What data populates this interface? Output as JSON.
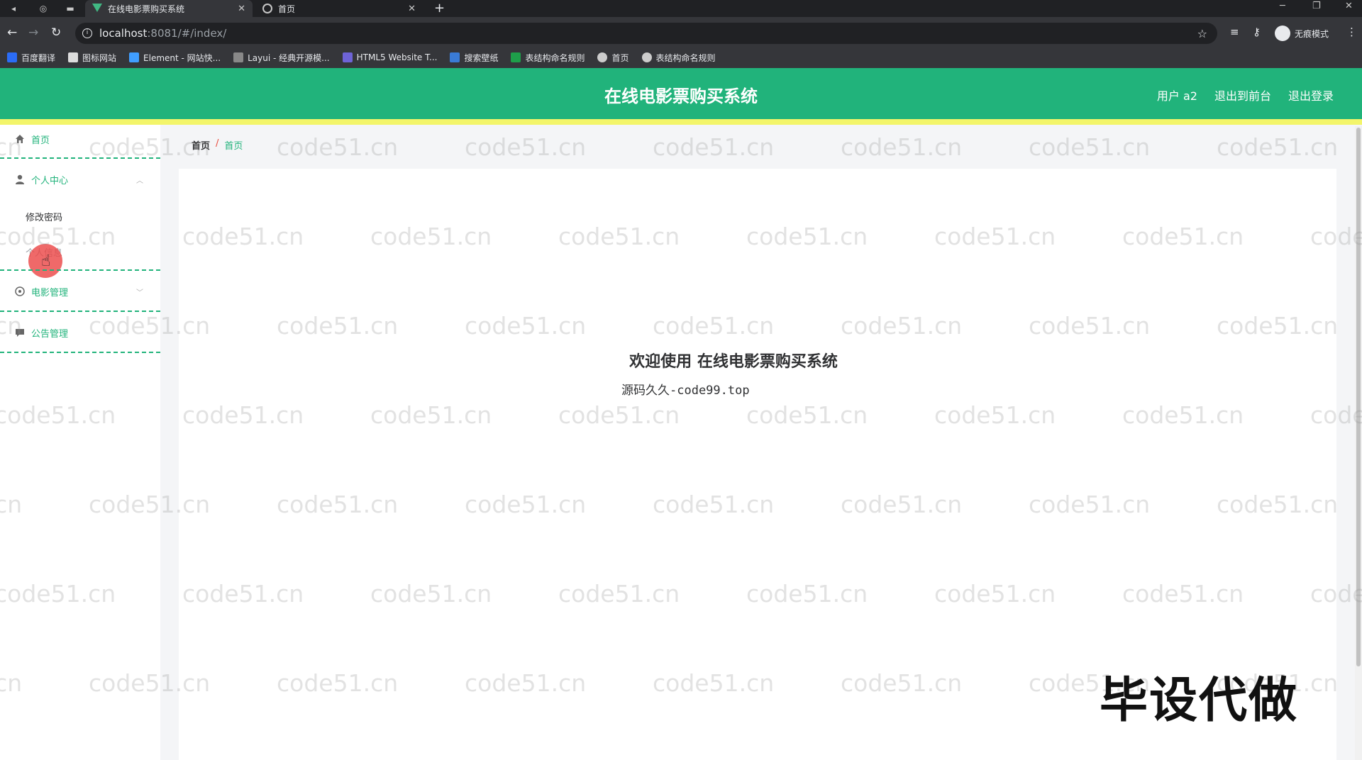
{
  "browser": {
    "tabs": [
      {
        "title": "在线电影票购买系统",
        "active": true,
        "favicon": "vue-logo-icon"
      },
      {
        "title": "首页",
        "active": false,
        "favicon": "globe-icon"
      }
    ],
    "url_host": "localhost",
    "url_rest": ":8081/#/index/",
    "incognito_label": "无痕模式",
    "bookmarks": [
      {
        "label": "百度翻译",
        "color": "#2b6cf6"
      },
      {
        "label": "图标网站",
        "color": "#dddddd"
      },
      {
        "label": "Element - 网站快...",
        "color": "#409eff"
      },
      {
        "label": "Layui - 经典开源模...",
        "color": "#888888"
      },
      {
        "label": "HTML5 Website T...",
        "color": "#6e63d6"
      },
      {
        "label": "搜索壁纸",
        "color": "#3a7bd5"
      },
      {
        "label": "表结构命名规则",
        "color": "#1e9e4a"
      },
      {
        "label": "首页",
        "color": "#cccccc"
      },
      {
        "label": "表结构命名规则",
        "color": "#cccccc"
      }
    ]
  },
  "header": {
    "title": "在线电影票购买系统",
    "links": [
      "用户 a2",
      "退出到前台",
      "退出登录"
    ],
    "color": "#21b37b"
  },
  "sidebar": {
    "home": "首页",
    "personal_center": "个人中心",
    "sub_items": [
      "修改密码",
      "个人信息"
    ],
    "movie_mgmt": "电影管理",
    "notice_mgmt": "公告管理"
  },
  "breadcrumb": [
    "首页",
    "首页"
  ],
  "main": {
    "welcome": "欢迎使用 在线电影票购买系统",
    "source": "源码久久-code99.top"
  },
  "watermark": {
    "text": "code51.cn",
    "stamp": "毕设代做"
  }
}
